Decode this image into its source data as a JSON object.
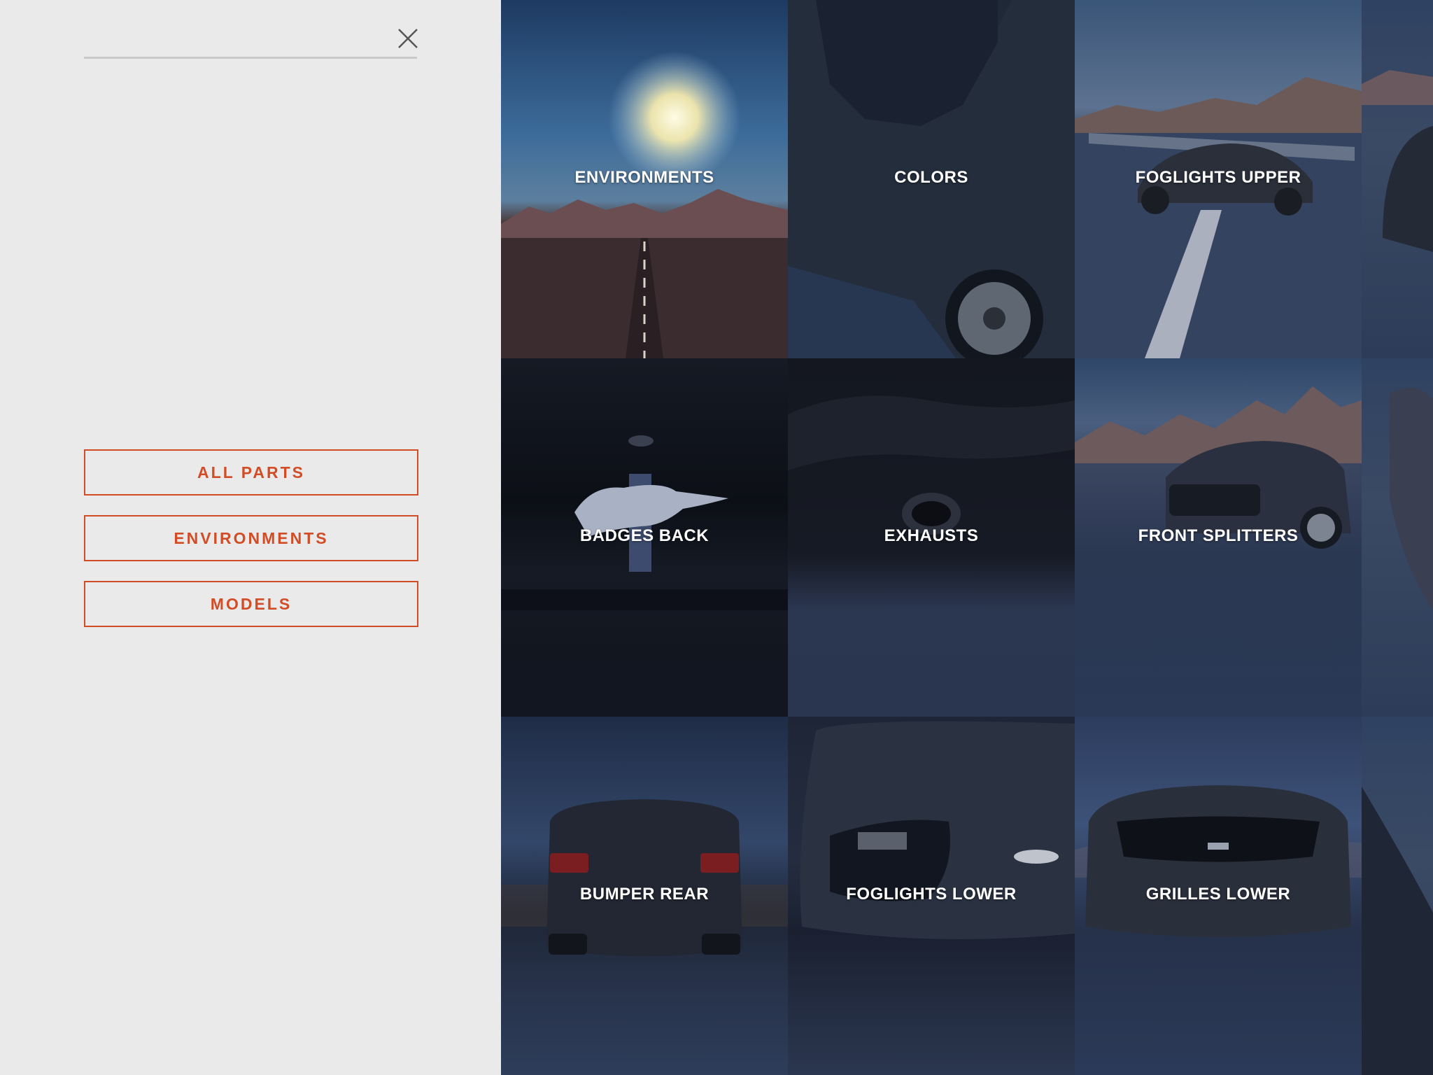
{
  "search": {
    "value": "",
    "placeholder": ""
  },
  "filters": {
    "all_parts": "ALL PARTS",
    "environments": "ENVIRONMENTS",
    "models": "MODELS"
  },
  "tiles": [
    {
      "label": "ENVIRONMENTS"
    },
    {
      "label": "COLORS"
    },
    {
      "label": "FOGLIGHTS UPPER"
    },
    {
      "label": "BADGES BACK"
    },
    {
      "label": "EXHAUSTS"
    },
    {
      "label": "FRONT SPLITTERS"
    },
    {
      "label": "BUMPER REAR"
    },
    {
      "label": "FOGLIGHTS LOWER"
    },
    {
      "label": "GRILLES LOWER"
    }
  ],
  "colors": {
    "accent": "#d24c26",
    "panel_background": "#eaeaea",
    "search_underline": "#c9c9c9"
  },
  "icons": {
    "close": "close-icon"
  }
}
